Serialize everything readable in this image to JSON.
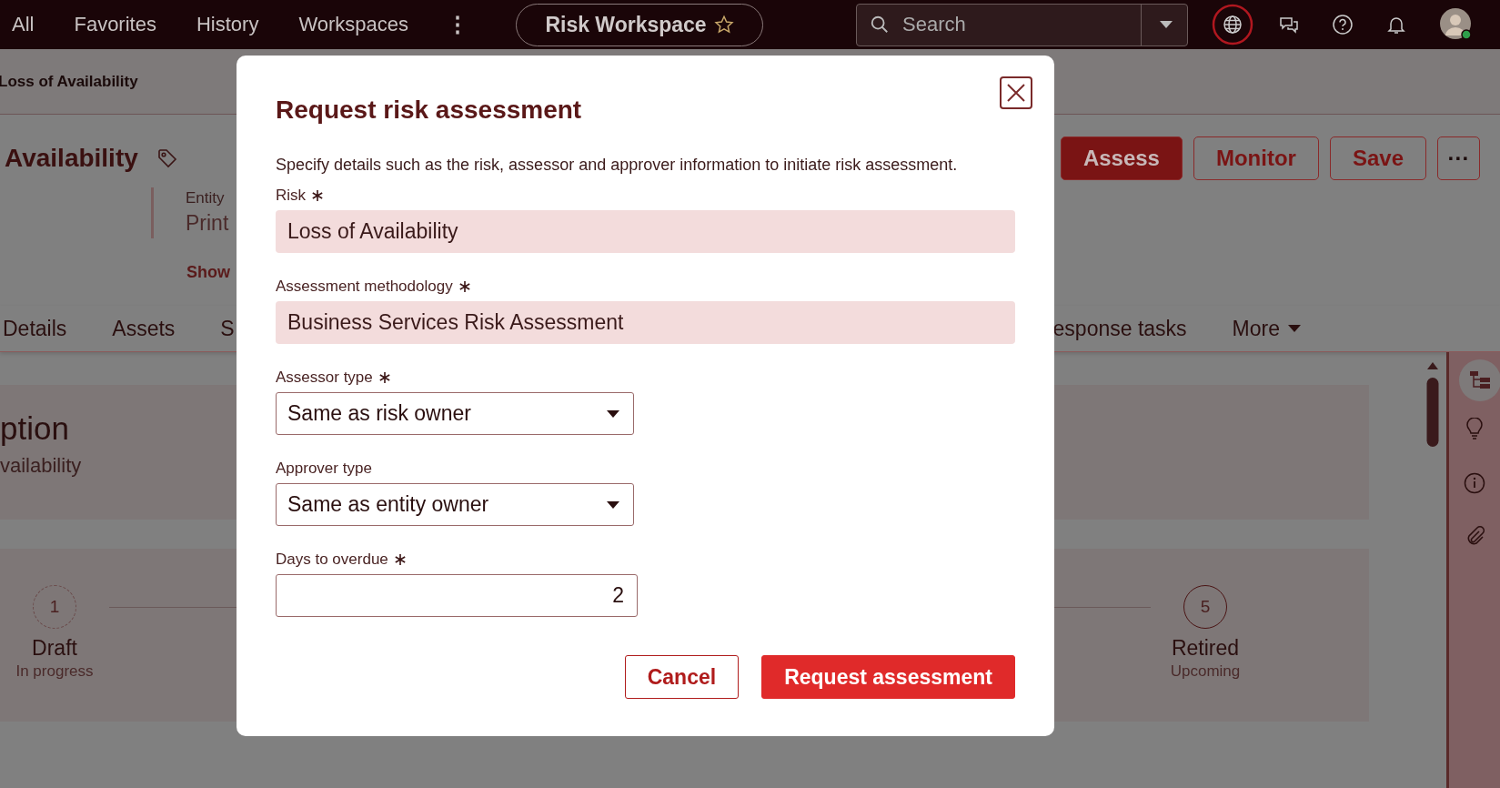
{
  "top_nav": {
    "items": [
      "All",
      "Favorites",
      "History",
      "Workspaces"
    ],
    "more": "⋮",
    "workspace": "Risk Workspace",
    "search": {
      "placeholder": "Search"
    }
  },
  "breadcrumb": "Loss of Availability",
  "record": {
    "title": "Availability",
    "actions": [
      {
        "label": "Assess",
        "primary": true
      },
      {
        "label": "Monitor",
        "primary": false
      },
      {
        "label": "Save",
        "primary": false
      }
    ],
    "more_actions": "···",
    "fields": [
      {
        "label": "Entity",
        "value": "Print"
      }
    ],
    "show_more": "Show"
  },
  "tabs": [
    "Details",
    "Assets",
    "S"
  ],
  "tabs_right": [
    "esponse tasks"
  ],
  "tabs_more": "More",
  "section": {
    "title": "ption",
    "text": "vailability"
  },
  "stages": [
    {
      "number": "1",
      "name": "Draft",
      "status": "In progress",
      "current": true
    },
    {
      "number": "5",
      "name": "Retired",
      "status": "Upcoming",
      "current": false
    }
  ],
  "dialog": {
    "title": "Request risk assessment",
    "description": "Specify details such as the risk, assessor and approver information to initiate risk assessment.",
    "fields": [
      {
        "kind": "text",
        "label": "Risk",
        "required": true,
        "value": "Loss of Availability"
      },
      {
        "kind": "text",
        "label": "Assessment methodology",
        "required": true,
        "value": "Business Services Risk Assessment"
      },
      {
        "kind": "select",
        "label": "Assessor type",
        "required": true,
        "value": "Same as risk owner"
      },
      {
        "kind": "select",
        "label": "Approver type",
        "required": false,
        "value": "Same as entity owner"
      },
      {
        "kind": "number",
        "label": "Days to overdue",
        "required": true,
        "value": "2"
      }
    ],
    "buttons": [
      {
        "label": "Cancel",
        "primary": false
      },
      {
        "label": "Request assessment",
        "primary": true
      }
    ]
  }
}
